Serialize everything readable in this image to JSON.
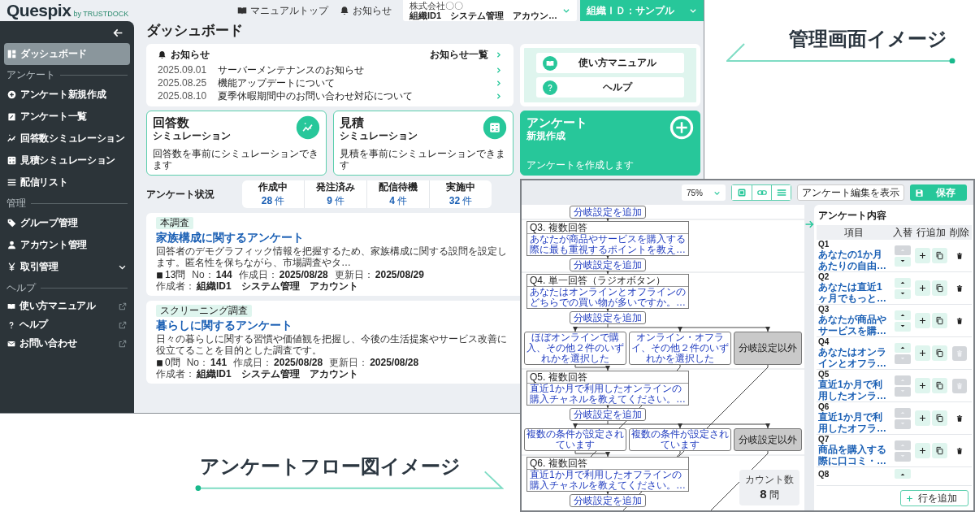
{
  "captions": [
    "管理画面イメージ",
    "アンケートフロー図イメージ"
  ],
  "admin_screen": {
    "logo": {
      "name": "Quespix",
      "byline": "by TRUSTDOCK"
    },
    "header": {
      "links": [
        "マニュアルトップ",
        "お知らせ"
      ],
      "account": {
        "company": "株式会社〇〇",
        "user": "組織ID1　システム管理　アカウン…"
      },
      "organization": "組織ＩＤ：サンプル"
    },
    "sidebar": {
      "items": [
        {
          "kind": "nav",
          "label": "ダッシュボード",
          "selected": true
        },
        {
          "kind": "section",
          "label": "アンケート"
        },
        {
          "kind": "nav",
          "label": "アンケート新規作成",
          "selected": false
        },
        {
          "kind": "nav",
          "label": "アンケート一覧",
          "selected": false
        },
        {
          "kind": "nav",
          "label": "回答数シミュレーション",
          "selected": false
        },
        {
          "kind": "nav",
          "label": "見積シミュレーション",
          "selected": false
        },
        {
          "kind": "nav",
          "label": "配信リスト",
          "selected": false
        },
        {
          "kind": "section",
          "label": "管理"
        },
        {
          "kind": "nav",
          "label": "グループ管理",
          "selected": false
        },
        {
          "kind": "nav",
          "label": "アカウント管理",
          "selected": false
        },
        {
          "kind": "group",
          "label": "取引管理",
          "expanded": false
        },
        {
          "kind": "section",
          "label": "ヘルプ"
        },
        {
          "kind": "external",
          "label": "使い方マニュアル"
        },
        {
          "kind": "external",
          "label": "ヘルプ"
        },
        {
          "kind": "external",
          "label": "お問い合わせ"
        }
      ]
    },
    "page_title": "ダッシュボード",
    "news": {
      "title": "お知らせ",
      "all_link": "お知らせ一覧",
      "items": [
        {
          "date": "2025.09.01",
          "title": "サーバーメンテナンスのお知らせ"
        },
        {
          "date": "2025.08.25",
          "title": "機能アップデートについて"
        },
        {
          "date": "2025.08.10",
          "title": "夏季休暇期間中のお問い合わせ対応について"
        }
      ]
    },
    "help_links": [
      "使い方マニュアル",
      "ヘルプ"
    ],
    "cards": [
      {
        "kind": "outline",
        "title": "回答数",
        "subtitle": "シミュレーション",
        "description": "回答数を事前にシミュレーションできます"
      },
      {
        "kind": "outline",
        "title": "見積",
        "subtitle": "シミュレーション",
        "description": "見積を事前にシミュレーションできます"
      },
      {
        "kind": "filled",
        "title": "アンケート",
        "subtitle": "新規作成",
        "description": "アンケートを作成します"
      }
    ],
    "survey_status": {
      "title": "アンケート状況",
      "items": [
        {
          "label": "作成中",
          "count": "28",
          "unit": "件"
        },
        {
          "label": "発注済み",
          "count": "9",
          "unit": "件"
        },
        {
          "label": "配信待機",
          "count": "4",
          "unit": "件"
        },
        {
          "label": "実施中",
          "count": "32",
          "unit": "件"
        }
      ]
    },
    "surveys": [
      {
        "tag": "本調査",
        "title": "家族構成に関するアンケート",
        "description": "回答者のデモグラフィック情報を把握するため、家族構成に関する設問を設定します。匿名性を保ちながら、市場調査やタ…",
        "question_count": "13問",
        "meta": [
          {
            "label": "No：",
            "value": "144"
          },
          {
            "label": "作成日：",
            "value": "2025/08/28"
          },
          {
            "label": "更新日：",
            "value": "2025/08/29"
          },
          {
            "label": "作成者：",
            "value": "組織ID1　システム管理　アカウント"
          }
        ]
      },
      {
        "tag": "スクリーニング調査",
        "title": "暮らしに関するアンケート",
        "description": "日々の暮らしに関する習慣や価値観を把握し、今後の生活提案やサービス改善に役立てることを目的とした調査です。",
        "question_count": "0問",
        "meta": [
          {
            "label": "No：",
            "value": "141"
          },
          {
            "label": "作成日：",
            "value": "2025/08/28"
          },
          {
            "label": "更新日：",
            "value": "2025/08/28"
          },
          {
            "label": "作成者：",
            "value": "組織ID1　システム管理　アカウント"
          }
        ]
      }
    ]
  },
  "flow_screen": {
    "toolbar": {
      "zoom": "75%",
      "edit_button": "アンケート編集を表示",
      "save_button": "保存"
    },
    "steps": [
      {
        "kind": "branch_add",
        "label": "分岐設定を追加"
      },
      {
        "kind": "question",
        "title": "Q3. 複数回答",
        "text": "あなたが商品やサービスを購入する際に最も重視するポイントを教え…"
      },
      {
        "kind": "branch_add",
        "label": "分岐設定を追加"
      },
      {
        "kind": "question",
        "title": "Q4. 単一回答（ラジオボタン）",
        "text": "あなたはオンラインとオフラインのどちらでの買い物が多いですか。…"
      },
      {
        "kind": "branch_add",
        "label": "分岐設定を追加"
      },
      {
        "kind": "branches",
        "options": [
          {
            "label": "ほぼオンラインで購入、その他２件のいずれかを選択した",
            "fallback": false
          },
          {
            "label": "オンライン・オフライ、その他２件のいずれかを選択した",
            "fallback": false
          },
          {
            "label": "分岐設定以外",
            "fallback": true
          }
        ]
      },
      {
        "kind": "question",
        "title": "Q5. 複数回答",
        "text": "直近1か月で利用したオンラインの購入チャネルを教えてください。…"
      },
      {
        "kind": "branch_add",
        "label": "分岐設定を追加"
      },
      {
        "kind": "branches",
        "options": [
          {
            "label": "複数の条件が設定されています",
            "fallback": false
          },
          {
            "label": "複数の条件が設定されています",
            "fallback": false
          },
          {
            "label": "分岐設定以外",
            "fallback": true
          }
        ]
      },
      {
        "kind": "question",
        "title": "Q6. 複数回答",
        "text": "直近1か月で利用したオフラインの購入チャネルを教えてください。…"
      },
      {
        "kind": "branch_add",
        "label": "分岐設定を追加"
      }
    ],
    "count": {
      "label": "カウント数",
      "value": "8",
      "unit": "問"
    },
    "panel": {
      "title": "アンケート内容",
      "columns": [
        "項目",
        "入替",
        "行追加",
        "削除"
      ],
      "rows": [
        {
          "number": "Q1",
          "text": "あなたの1か月あたりの自由…",
          "up_disabled": true,
          "down_disabled": false,
          "delete_disabled": false
        },
        {
          "number": "Q2",
          "text": "あなたは直近1ヶ月でもっと…",
          "up_disabled": false,
          "down_disabled": false,
          "delete_disabled": false
        },
        {
          "number": "Q3",
          "text": "あなたが商品やサービスを購…",
          "up_disabled": false,
          "down_disabled": false,
          "delete_disabled": false
        },
        {
          "number": "Q4",
          "text": "あなたはオンラインとオフラ…",
          "up_disabled": false,
          "down_disabled": true,
          "delete_disabled": true
        },
        {
          "number": "Q5",
          "text": "直近1か月で利用したオンラ…",
          "up_disabled": true,
          "down_disabled": true,
          "delete_disabled": true
        },
        {
          "number": "Q6",
          "text": "直近1か月で利用したオフラ…",
          "up_disabled": true,
          "down_disabled": true,
          "delete_disabled": false
        },
        {
          "number": "Q7",
          "text": "商品を購入する際に口コミ・…",
          "up_disabled": true,
          "down_disabled": true,
          "delete_disabled": false
        },
        {
          "number": "Q8",
          "up_disabled": false
        }
      ],
      "add_row_button": "行を追加"
    }
  }
}
